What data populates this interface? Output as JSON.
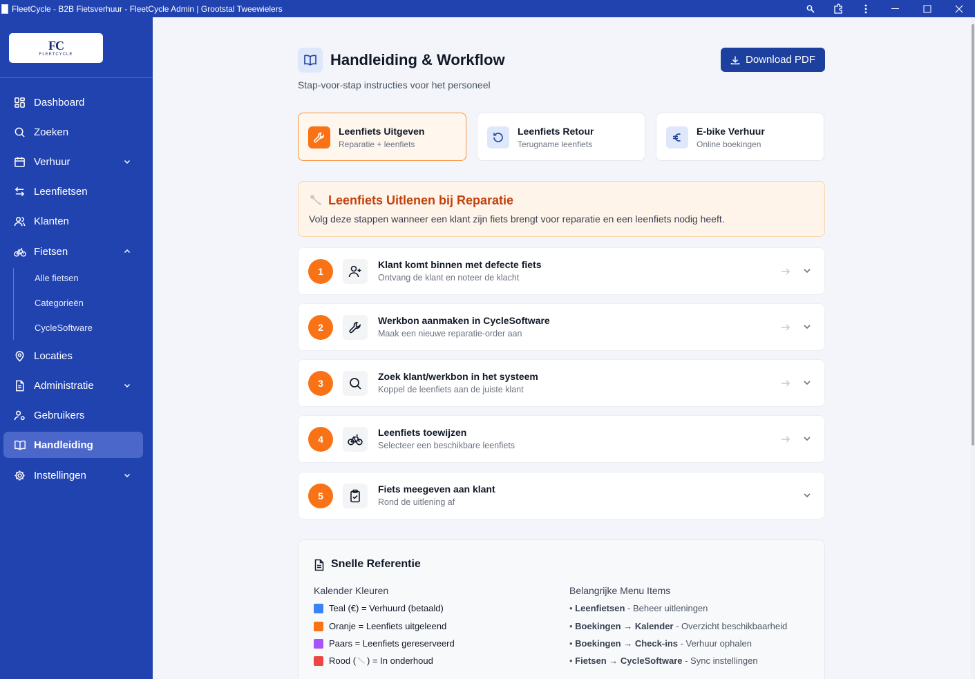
{
  "window": {
    "title": "FleetCycle - B2B Fietsverhuur - FleetCycle Admin | Grootstal Tweewielers"
  },
  "logo": {
    "mark": "FC",
    "text": "FLEETCYCLE"
  },
  "sidebar": {
    "items": [
      {
        "label": "Dashboard",
        "icon": "dashboard-icon"
      },
      {
        "label": "Zoeken",
        "icon": "search-icon"
      },
      {
        "label": "Verhuur",
        "icon": "calendar-icon"
      },
      {
        "label": "Leenfietsen",
        "icon": "swap-icon"
      },
      {
        "label": "Klanten",
        "icon": "users-icon"
      },
      {
        "label": "Fietsen",
        "icon": "bike-icon"
      },
      {
        "label": "Locaties",
        "icon": "map-pin-icon"
      },
      {
        "label": "Administratie",
        "icon": "file-icon"
      },
      {
        "label": "Gebruikers",
        "icon": "user-cog-icon"
      },
      {
        "label": "Handleiding",
        "icon": "book-icon"
      },
      {
        "label": "Instellingen",
        "icon": "gear-icon"
      }
    ],
    "fietsen_sub": [
      "Alle fietsen",
      "Categorieën",
      "CycleSoftware"
    ]
  },
  "header": {
    "title": "Handleiding & Workflow",
    "subtitle": "Stap-voor-stap instructies voor het personeel",
    "download_label": "Download PDF"
  },
  "tabs": [
    {
      "title": "Leenfiets Uitgeven",
      "subtitle": "Reparatie + leenfiets",
      "icon": "wrench-icon"
    },
    {
      "title": "Leenfiets Retour",
      "subtitle": "Terugname leenfiets",
      "icon": "rotate-icon"
    },
    {
      "title": "E-bike Verhuur",
      "subtitle": "Online boekingen",
      "icon": "euro-icon"
    }
  ],
  "banner": {
    "title": "Leenfiets Uitlenen bij Reparatie",
    "description": "Volg deze stappen wanneer een klant zijn fiets brengt voor reparatie en een leenfiets nodig heeft."
  },
  "steps": [
    {
      "number": "1",
      "title": "Klant komt binnen met defecte fiets",
      "subtitle": "Ontvang de klant en noteer de klacht",
      "icon": "user-plus-icon"
    },
    {
      "number": "2",
      "title": "Werkbon aanmaken in CycleSoftware",
      "subtitle": "Maak een nieuwe reparatie-order aan",
      "icon": "wrench-icon"
    },
    {
      "number": "3",
      "title": "Zoek klant/werkbon in het systeem",
      "subtitle": "Koppel de leenfiets aan de juiste klant",
      "icon": "search-icon"
    },
    {
      "number": "4",
      "title": "Leenfiets toewijzen",
      "subtitle": "Selecteer een beschikbare leenfiets",
      "icon": "bike-icon"
    },
    {
      "number": "5",
      "title": "Fiets meegeven aan klant",
      "subtitle": "Rond de uitlening af",
      "icon": "clipboard-check-icon"
    }
  ],
  "reference": {
    "title": "Snelle Referentie",
    "calendar_heading": "Kalender Kleuren",
    "calendar_items": [
      {
        "text": "Teal (€) = Verhuurd (betaald)",
        "color": "#3b82f6"
      },
      {
        "text": "Oranje = Leenfiets uitgeleend",
        "color": "#f97316"
      },
      {
        "text": "Paars = Leenfiets gereserveerd",
        "color": "#a855f7"
      },
      {
        "text_before": "Rood (",
        "text_after": ") = In onderhoud",
        "color": "#ef4444"
      }
    ],
    "menu_heading": "Belangrijke Menu Items",
    "menu_items": [
      {
        "bold": "Leenfietsen",
        "rest": " - Beheer uitleningen"
      },
      {
        "bold": "Boekingen → Kalender",
        "rest": " - Overzicht beschikbaarheid"
      },
      {
        "bold": "Boekingen → Check-ins",
        "rest": " - Verhuur ophalen"
      },
      {
        "bold": "Fietsen → CycleSoftware",
        "rest": " - Sync instellingen"
      }
    ]
  }
}
